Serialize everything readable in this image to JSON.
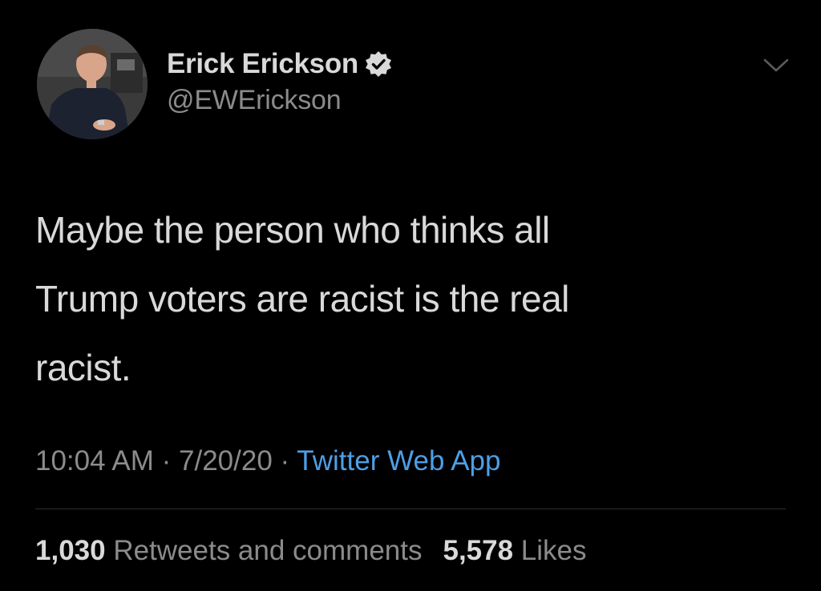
{
  "tweet": {
    "author": {
      "display_name": "Erick Erickson",
      "handle": "@EWErickson",
      "verified": true
    },
    "text": "Maybe the person who thinks all\nTrump voters are racist is the real\nracist.",
    "time": "10:04 AM",
    "date": "7/20/20",
    "separator": "·",
    "source": "Twitter Web App",
    "retweets_count": "1,030",
    "retweets_label": "Retweets and comments",
    "likes_count": "5,578",
    "likes_label": "Likes"
  },
  "icons": {
    "verified": "verified-badge-icon",
    "more": "chevron-down-icon"
  },
  "colors": {
    "background": "#000000",
    "primary_text": "#d9d9d9",
    "secondary_text": "#8b8b8b",
    "link": "#4d9fe6",
    "divider": "#2e2e2e"
  }
}
